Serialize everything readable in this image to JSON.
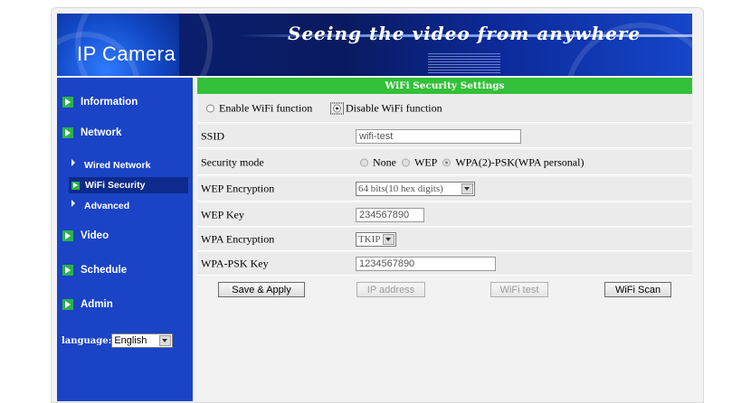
{
  "banner": {
    "logo": "IP Camera",
    "slogan": "Seeing the video from anywhere"
  },
  "sidebar": {
    "items": [
      {
        "label": "Information"
      },
      {
        "label": "Network"
      },
      {
        "label": "Video"
      },
      {
        "label": "Schedule"
      },
      {
        "label": "Admin"
      }
    ],
    "network_sub": [
      {
        "label": "Wired Network"
      },
      {
        "label": "WiFi Security"
      },
      {
        "label": "Advanced"
      }
    ],
    "language_label": "language:",
    "language_value": "English"
  },
  "wifi": {
    "section_title": "WiFi Security Settings",
    "enable_label": "Enable WiFi function",
    "disable_label": "Disable WiFi function",
    "ssid_label": "SSID",
    "ssid_value": "wifi-test",
    "security_mode_label": "Security mode",
    "security_options": [
      "None",
      "WEP",
      "WPA(2)-PSK(WPA personal)"
    ],
    "wep_encryption_label": "WEP Encryption",
    "wep_encryption_value": "64 bits(10 hex digits)",
    "wep_key_label": "WEP Key",
    "wep_key_value": "234567890",
    "wpa_encryption_label": "WPA Encryption",
    "wpa_encryption_value": "TKIP",
    "wpa_psk_label": "WPA-PSK Key",
    "wpa_psk_value": "1234567890"
  },
  "buttons": {
    "save": "Save & Apply",
    "ip_address": "IP address",
    "wifi_test": "WiFi test",
    "wifi_scan": "WiFi Scan"
  },
  "colors": {
    "sidebar_bg": "#1a43c6",
    "title_bar": "#33c03a",
    "row_bg": "#ebebeb"
  }
}
